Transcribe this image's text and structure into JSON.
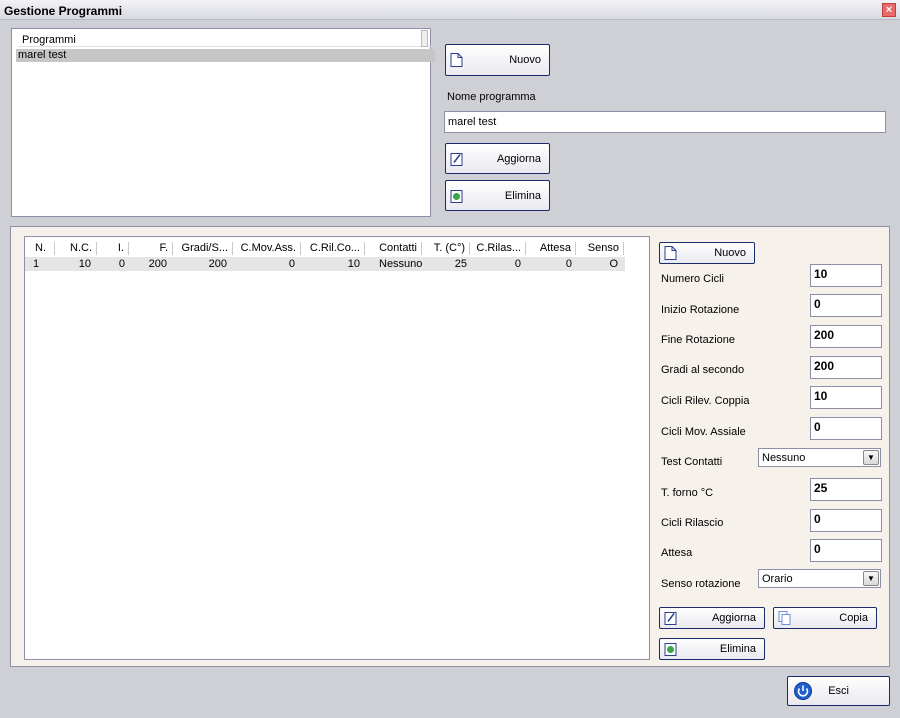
{
  "window": {
    "title": "Gestione Programmi",
    "close": "×"
  },
  "programs": {
    "header": "Programmi",
    "items": [
      "marel test"
    ],
    "new_label": "Nuovo",
    "name_label": "Nome programma",
    "name_value": "marel test",
    "update_label": "Aggiorna",
    "delete_label": "Elimina"
  },
  "steps_table": {
    "columns": [
      "N.",
      "N.C.",
      "I.",
      "F.",
      "Gradi/S...",
      "C.Mov.Ass.",
      "C.Ril.Co...",
      "Contatti",
      "T. (C°)",
      "C.Rilas...",
      "Attesa",
      "Senso"
    ],
    "rows": [
      [
        "1",
        "10",
        "0",
        "200",
        "200",
        "0",
        "10",
        "Nessuno",
        "25",
        "0",
        "0",
        "O"
      ]
    ]
  },
  "step_form": {
    "new_label": "Nuovo",
    "fields": [
      {
        "label": "Numero Cicli",
        "value": "10"
      },
      {
        "label": "Inizio Rotazione",
        "value": "0"
      },
      {
        "label": "Fine Rotazione",
        "value": "200"
      },
      {
        "label": "Gradi al secondo",
        "value": "200"
      },
      {
        "label": "Cicli Rilev. Coppia",
        "value": "10"
      },
      {
        "label": "Cicli Mov. Assiale",
        "value": "0"
      },
      {
        "label": "Test Contatti",
        "value": "Nessuno"
      },
      {
        "label": "T. forno °C",
        "value": "25"
      },
      {
        "label": "Cicli Rilascio",
        "value": "0"
      },
      {
        "label": "Attesa",
        "value": "0"
      },
      {
        "label": "Senso rotazione",
        "value": "Orario"
      }
    ],
    "update_label": "Aggiorna",
    "copy_label": "Copia",
    "delete_label": "Elimina"
  },
  "footer": {
    "exit_label": "Esci"
  },
  "icons": {
    "new": "document-icon",
    "update": "edit-icon",
    "delete": "recycle-icon",
    "copy": "copy-icon",
    "exit": "power-icon"
  }
}
